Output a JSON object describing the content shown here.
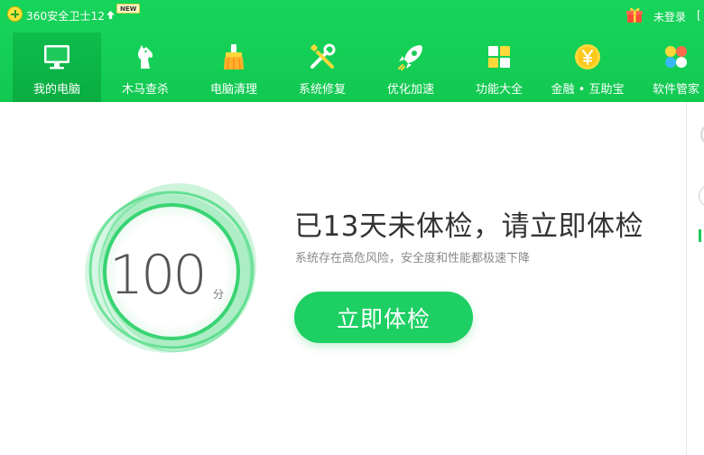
{
  "titlebar": {
    "app_title": "360安全卫士12",
    "new_badge": "NEW",
    "login_label": "未登录"
  },
  "nav": {
    "tabs": [
      {
        "label": "我的电脑",
        "icon": "monitor-icon",
        "active": true
      },
      {
        "label": "木马查杀",
        "icon": "horse-icon",
        "active": false
      },
      {
        "label": "电脑清理",
        "icon": "broom-icon",
        "active": false
      },
      {
        "label": "系统修复",
        "icon": "wrench-screwdriver-icon",
        "active": false
      },
      {
        "label": "优化加速",
        "icon": "rocket-icon",
        "active": false
      },
      {
        "label": "功能大全",
        "icon": "grid-icon",
        "active": false
      },
      {
        "label": "金融 • 互助宝",
        "icon": "coin-icon",
        "active": false
      },
      {
        "label": "软件管家",
        "icon": "software-icon",
        "active": false
      }
    ]
  },
  "main": {
    "score": "100",
    "score_unit": "分",
    "headline": "已13天未体检，请立即体检",
    "subline": "系统存在高危风险，安全度和性能都极速下降",
    "check_button": "立即体检"
  },
  "colors": {
    "brand_green": "#14cf56",
    "button_green": "#1ecf63",
    "ring_green": "#2bd36a"
  }
}
